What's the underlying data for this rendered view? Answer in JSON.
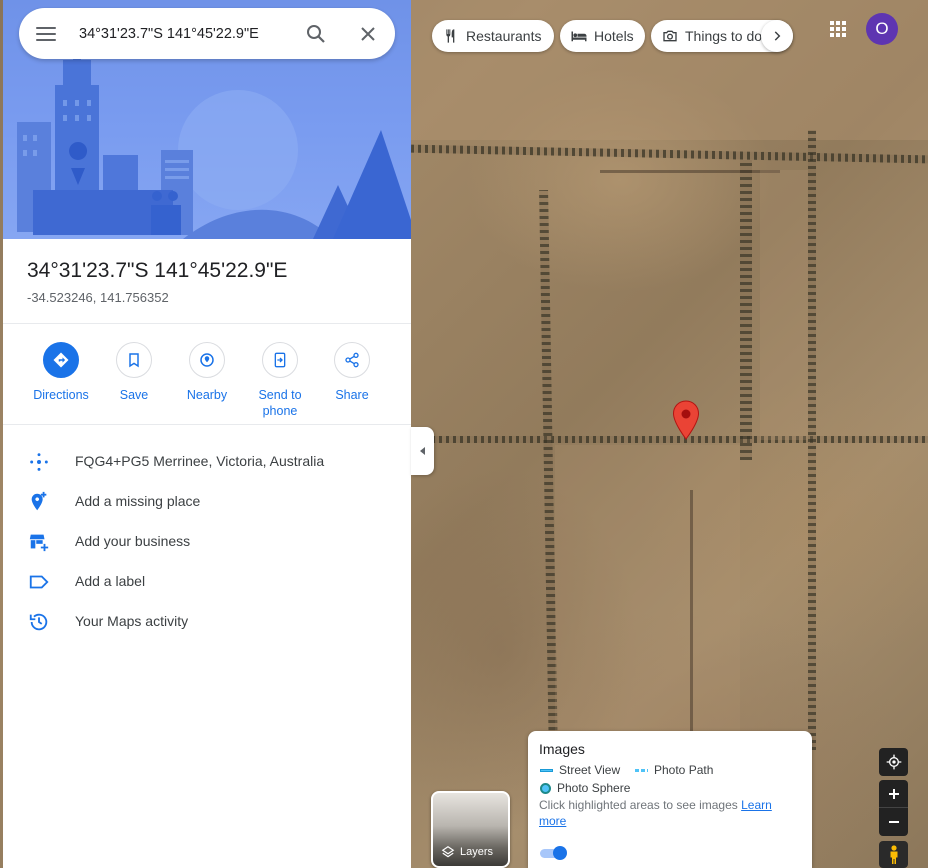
{
  "search": {
    "query": "34°31'23.7\"S 141°45'22.9\"E"
  },
  "chips": [
    {
      "label": "Restaurants",
      "icon": "fork-knife-icon"
    },
    {
      "label": "Hotels",
      "icon": "bed-icon"
    },
    {
      "label": "Things to do",
      "icon": "camera-icon"
    }
  ],
  "account": {
    "avatar_letter": "O",
    "avatar_color": "#5e35b1"
  },
  "place": {
    "title": "34°31'23.7\"S 141°45'22.9\"E",
    "coords": "-34.523246, 141.756352"
  },
  "actions": [
    {
      "label": "Directions",
      "icon": "directions-icon"
    },
    {
      "label": "Save",
      "icon": "bookmark-icon"
    },
    {
      "label": "Nearby",
      "icon": "nearby-icon"
    },
    {
      "label": "Send to phone",
      "icon": "send-to-phone-icon"
    },
    {
      "label": "Share",
      "icon": "share-icon"
    }
  ],
  "info": [
    {
      "text": "FQG4+PG5 Merrinee, Victoria, Australia",
      "icon": "plus-code-icon"
    },
    {
      "text": "Add a missing place",
      "icon": "add-place-icon"
    },
    {
      "text": "Add your business",
      "icon": "add-business-icon"
    },
    {
      "text": "Add a label",
      "icon": "label-icon"
    },
    {
      "text": "Your Maps activity",
      "icon": "history-icon"
    }
  ],
  "images_legend": {
    "title": "Images",
    "street_view": "Street View",
    "photo_path": "Photo Path",
    "photo_sphere": "Photo Sphere",
    "hint": "Click highlighted areas to see images",
    "learn_more": "Learn more"
  },
  "layers": {
    "label": "Layers"
  },
  "colors": {
    "accent": "#1a73e8",
    "marker": "#ea4335",
    "street_view": "#4fc3f7",
    "photo_sphere": "#4fc3f7"
  }
}
